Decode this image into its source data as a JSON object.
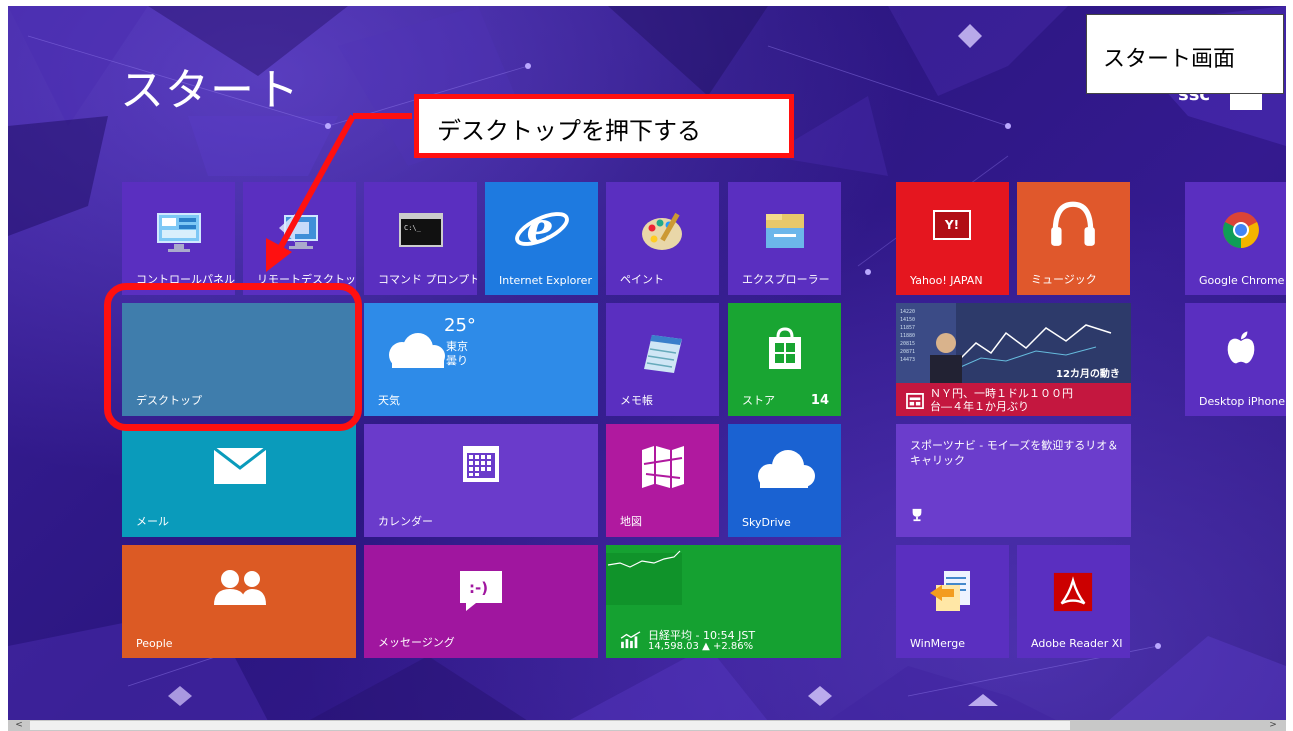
{
  "screen": {
    "title": "スタート",
    "user_name": "ssc"
  },
  "annotations": {
    "top_right_label": "スタート画面",
    "instruction": "デスクトップを押下する"
  },
  "tiles": {
    "control_panel": {
      "label": "コントロールパネル",
      "icon": "control-panel-icon",
      "color": "#5a2fc0"
    },
    "remote_desktop": {
      "label": "リモートデスクトップ",
      "icon": "remote-desktop-icon",
      "color": "#5a2fc0"
    },
    "command_prompt": {
      "label": "コマンド プロンプト",
      "icon": "command-prompt-icon",
      "color": "#5a2fc0"
    },
    "internet_explorer": {
      "label": "Internet Explorer",
      "icon": "internet-explorer-icon",
      "color": "#1e7ae0"
    },
    "paint": {
      "label": "ペイント",
      "icon": "paint-icon",
      "color": "#5a2fc0"
    },
    "explorer": {
      "label": "エクスプローラー",
      "icon": "folder-icon",
      "color": "#5a2fc0"
    },
    "desktop": {
      "label": "デスクトップ",
      "color": "#3f7dac"
    },
    "weather": {
      "label": "天気",
      "temperature": "25°",
      "city": "東京",
      "condition": "曇り",
      "icon": "cloud-icon",
      "color": "#2e8be8"
    },
    "notepad": {
      "label": "メモ帳",
      "icon": "notepad-icon",
      "color": "#5a2fc0"
    },
    "store": {
      "label": "ストア",
      "badge": "14",
      "icon": "store-icon",
      "color": "#19a532"
    },
    "mail": {
      "label": "メール",
      "icon": "mail-icon",
      "color": "#0a9bbb"
    },
    "calendar": {
      "label": "カレンダー",
      "icon": "calendar-icon",
      "color": "#6a3bcb"
    },
    "maps": {
      "label": "地図",
      "icon": "map-icon",
      "color": "#b0199f"
    },
    "skydrive": {
      "label": "SkyDrive",
      "icon": "cloud-icon",
      "color": "#1a62d2"
    },
    "people": {
      "label": "People",
      "icon": "people-icon",
      "color": "#dc5a24"
    },
    "messaging": {
      "label": "メッセージング",
      "icon": "message-icon",
      "color": "#a0169f"
    },
    "finance": {
      "label": "日経平均 - 10:54 JST",
      "value": "14,598.03 ▲ +2.86%",
      "icon": "finance-chart-icon",
      "color": "#15a131"
    },
    "yahoo": {
      "label": "Yahoo! JAPAN",
      "logo": "Y!",
      "color": "#e5161f"
    },
    "music": {
      "label": "ミュージック",
      "icon": "headphones-icon",
      "color": "#e0582c"
    },
    "chrome": {
      "label": "Google Chrome",
      "icon": "chrome-icon",
      "color": "#5a2fc0"
    },
    "news": {
      "headline": "ＮＹ円、一時１ドル１００円台―４年１か月ぶり",
      "photo_caption": "12カ月の動き",
      "icon": "news-icon",
      "color": "#c4173f"
    },
    "desktop_iphone": {
      "label": "Desktop iPhone",
      "icon": "apple-icon",
      "color": "#5a2fc0"
    },
    "sports": {
      "headline": "スポーツナビ - モイーズを歓迎するリオ＆キャリック",
      "icon": "trophy-icon",
      "color": "#6b3dcc"
    },
    "winmerge": {
      "label": "WinMerge",
      "icon": "winmerge-icon",
      "color": "#5a2fc0"
    },
    "adobe_reader": {
      "label": "Adobe Reader XI",
      "icon": "adobe-reader-icon",
      "color": "#5a2fc0"
    }
  },
  "scrollbar": {
    "left_arrow": "<",
    "right_arrow": ">"
  }
}
